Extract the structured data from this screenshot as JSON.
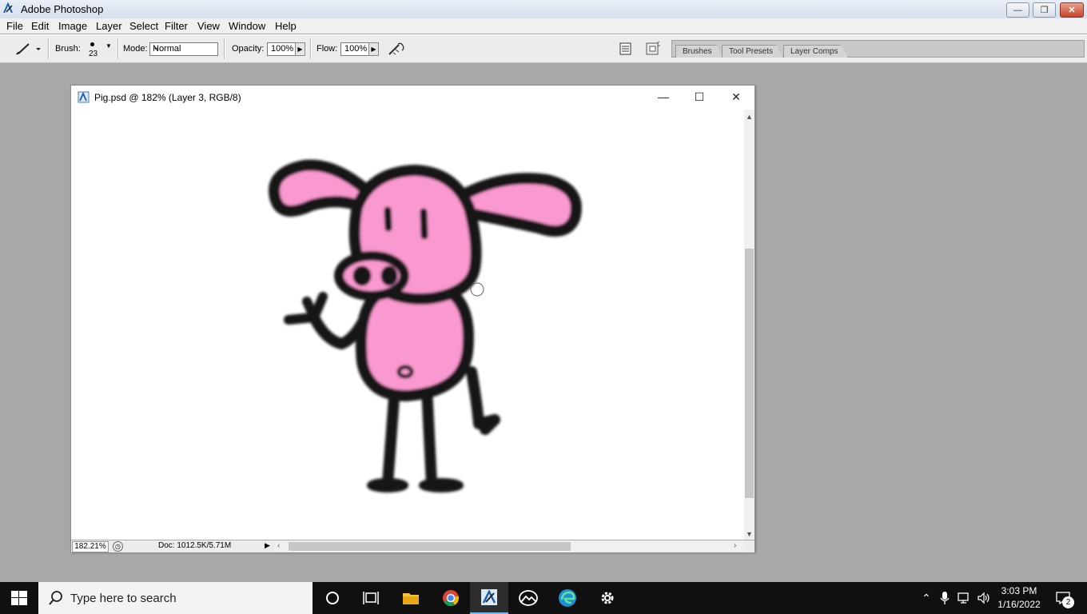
{
  "app": {
    "title": "Adobe Photoshop",
    "window_controls": {
      "minimize": "—",
      "restore": "❐",
      "close": "✕"
    }
  },
  "menu": [
    "File",
    "Edit",
    "Image",
    "Layer",
    "Select",
    "Filter",
    "View",
    "Window",
    "Help"
  ],
  "options": {
    "brush_label": "Brush:",
    "brush_size": "23",
    "mode_label": "Mode:",
    "mode_value": "Normal",
    "opacity_label": "Opacity:",
    "opacity_value": "100%",
    "flow_label": "Flow:",
    "flow_value": "100%"
  },
  "palette_tabs": [
    "Brushes",
    "Tool Presets",
    "Layer Comps"
  ],
  "document": {
    "title": "Pig.psd @ 182% (Layer 3, RGB/8)",
    "zoom": "182.21%",
    "doc_info": "Doc: 1012.5K/5.71M",
    "colors": {
      "pig_pink": "#f999cf",
      "outline": "#141414"
    }
  },
  "taskbar": {
    "search_placeholder": "Type here to search",
    "time": "3:03 PM",
    "date": "1/16/2022",
    "notification_count": "2"
  }
}
